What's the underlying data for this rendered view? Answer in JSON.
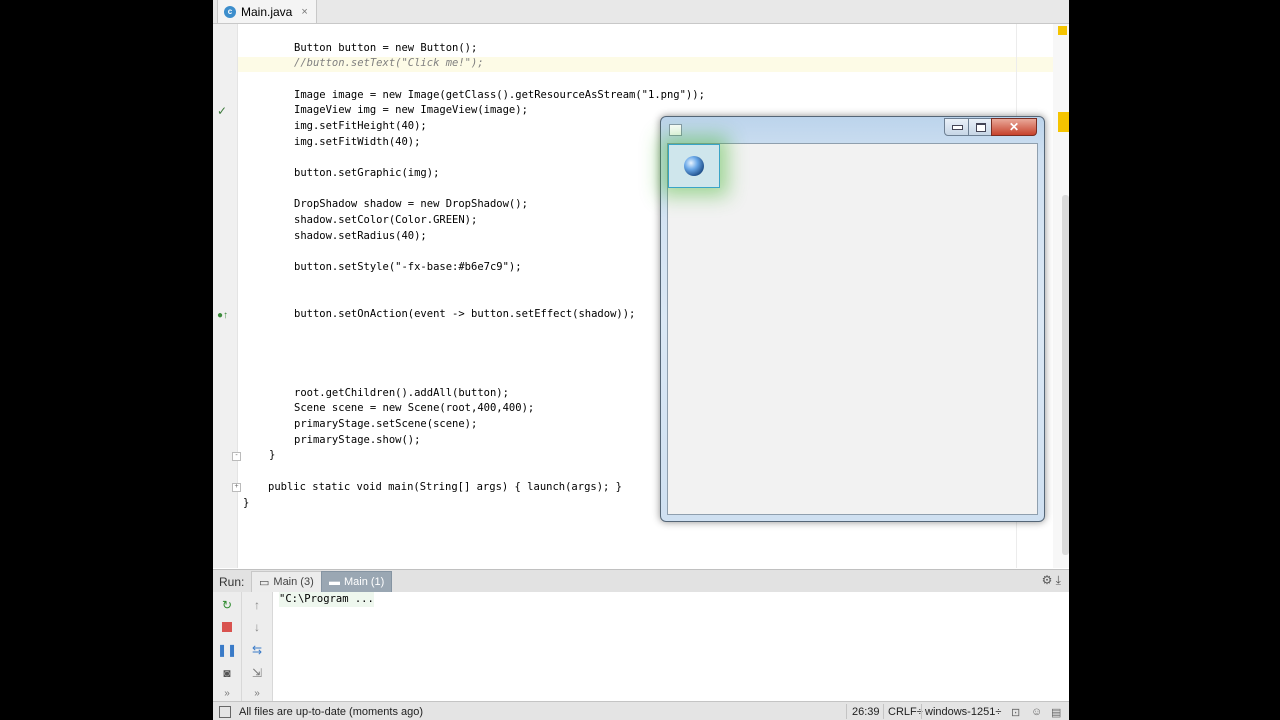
{
  "tab": {
    "label": "Main.java",
    "close": "×",
    "icon": "java-class-icon"
  },
  "code_lines": [
    {
      "id": "l1",
      "text": "Button button = new Button();"
    },
    {
      "id": "l2",
      "text": "//button.setText(\"Click me!\");"
    },
    {
      "id": "l3",
      "text": "Image image = new Image(getClass().getResourceAsStream(\"1.png\"));"
    },
    {
      "id": "l4",
      "text": "ImageView img = new ImageView(image);"
    },
    {
      "id": "l5",
      "text": "img.setFitHeight(40);"
    },
    {
      "id": "l6",
      "text": "img.setFitWidth(40);"
    },
    {
      "id": "l7",
      "text": "button.setGraphic(img);"
    },
    {
      "id": "l8",
      "text": "DropShadow shadow = new DropShadow();"
    },
    {
      "id": "l9",
      "text": "shadow.setColor(Color.GREEN);"
    },
    {
      "id": "l10",
      "text": "shadow.setRadius(40);"
    },
    {
      "id": "l11",
      "text": "button.setStyle(\"-fx-base:#b6e7c9\");"
    },
    {
      "id": "l12",
      "text": "button.setOnAction(event -> button.setEffect(shadow));"
    },
    {
      "id": "l13",
      "text": "root.getChildren().addAll(button);"
    },
    {
      "id": "l14",
      "text": "Scene scene = new Scene(root,400,400);"
    },
    {
      "id": "l15",
      "text": "primaryStage.setScene(scene);"
    },
    {
      "id": "l16",
      "text": "primaryStage.show();"
    },
    {
      "id": "l17",
      "text": "}"
    },
    {
      "id": "l18",
      "text": "public static void main(String[] args) { launch(args); }"
    },
    {
      "id": "l19",
      "text": "}"
    }
  ],
  "run_panel": {
    "label": "Run:",
    "tabs": [
      {
        "label": "Main (3)",
        "active": false
      },
      {
        "label": "Main (1)",
        "active": true
      }
    ],
    "console_output": "\"C:\\Program ..."
  },
  "status_bar": {
    "message": "All files are up-to-date (moments ago)",
    "position": "26:39",
    "line_separator": "CRLF÷",
    "encoding": "windows-1251÷"
  },
  "fx_window": {
    "close_label": "✕"
  },
  "colors": {
    "active_run_tab": "#9aa7b3",
    "button_glow": "#3cb428",
    "close_button": "#c7422c"
  }
}
